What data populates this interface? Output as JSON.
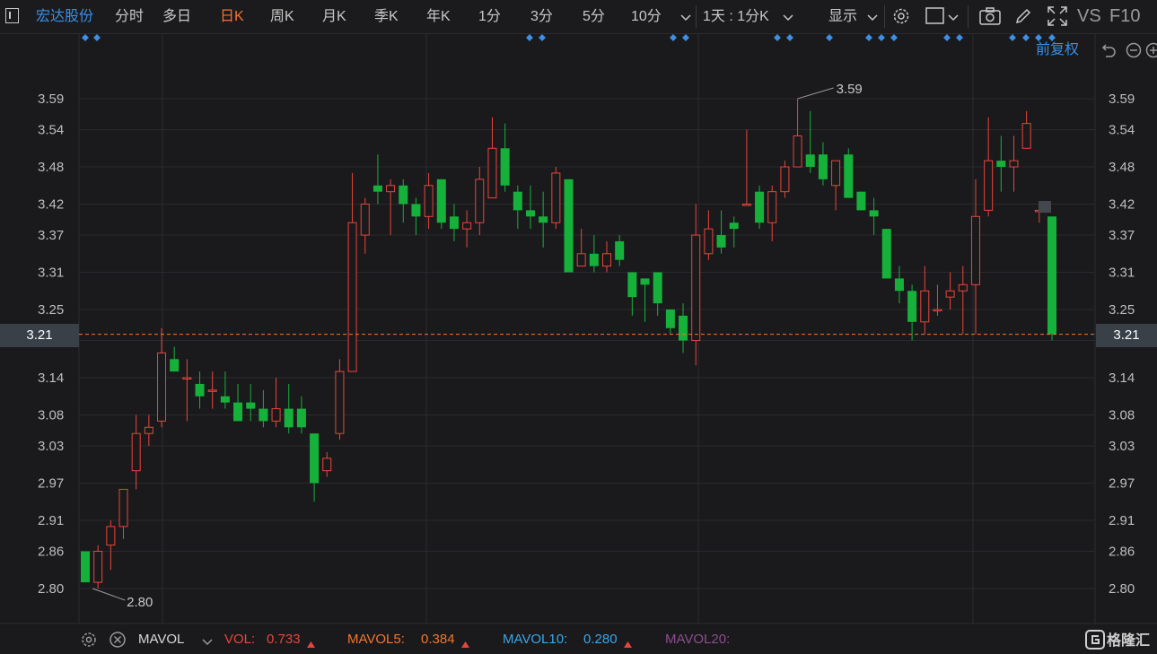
{
  "toolbar": {
    "stock_name": "宏达股份",
    "tabs": [
      "分时",
      "多日",
      "日K",
      "周K",
      "月K",
      "季K",
      "年K",
      "1分",
      "3分",
      "5分",
      "10分"
    ],
    "active_tab": "日K",
    "period_select": "1天 : 1分K",
    "display_label": "显示",
    "vs_label": "VS",
    "f10_label": "F10"
  },
  "adjust_label": "前复权",
  "axis": {
    "ticks": [
      "3.59",
      "3.54",
      "3.48",
      "3.42",
      "3.37",
      "3.31",
      "3.25",
      "3.20",
      "3.14",
      "3.08",
      "3.03",
      "2.97",
      "2.91",
      "2.86",
      "2.80"
    ],
    "current_price": "3.21",
    "high_label": "3.59",
    "low_label": "2.80"
  },
  "chart_data": {
    "type": "candlestick",
    "ylim": [
      2.77,
      3.63
    ],
    "current_price": 3.21,
    "high": 3.59,
    "low": 2.8,
    "candles": [
      [
        2.86,
        2.81,
        2.86,
        2.81
      ],
      [
        2.81,
        2.86,
        2.87,
        2.8
      ],
      [
        2.87,
        2.9,
        2.91,
        2.83
      ],
      [
        2.9,
        2.96,
        2.96,
        2.88
      ],
      [
        2.99,
        3.05,
        3.08,
        2.96
      ],
      [
        3.05,
        3.06,
        3.08,
        3.03
      ],
      [
        3.07,
        3.18,
        3.22,
        3.06
      ],
      [
        3.17,
        3.15,
        3.19,
        3.15
      ],
      [
        3.14,
        3.14,
        3.17,
        3.07
      ],
      [
        3.13,
        3.11,
        3.15,
        3.09
      ],
      [
        3.12,
        3.12,
        3.15,
        3.09
      ],
      [
        3.11,
        3.1,
        3.15,
        3.09
      ],
      [
        3.1,
        3.07,
        3.13,
        3.07
      ],
      [
        3.1,
        3.09,
        3.13,
        3.07
      ],
      [
        3.09,
        3.07,
        3.12,
        3.06
      ],
      [
        3.07,
        3.09,
        3.14,
        3.06
      ],
      [
        3.09,
        3.06,
        3.13,
        3.05
      ],
      [
        3.09,
        3.06,
        3.11,
        3.05
      ],
      [
        3.05,
        2.97,
        3.05,
        2.94
      ],
      [
        2.99,
        3.01,
        3.02,
        2.98
      ],
      [
        3.05,
        3.15,
        3.17,
        3.04
      ],
      [
        3.15,
        3.39,
        3.47,
        3.15
      ],
      [
        3.37,
        3.42,
        3.43,
        3.34
      ],
      [
        3.45,
        3.44,
        3.5,
        3.42
      ],
      [
        3.44,
        3.45,
        3.46,
        3.37
      ],
      [
        3.45,
        3.42,
        3.46,
        3.39
      ],
      [
        3.42,
        3.4,
        3.43,
        3.37
      ],
      [
        3.4,
        3.45,
        3.47,
        3.38
      ],
      [
        3.46,
        3.39,
        3.46,
        3.38
      ],
      [
        3.4,
        3.38,
        3.42,
        3.36
      ],
      [
        3.38,
        3.39,
        3.41,
        3.35
      ],
      [
        3.39,
        3.46,
        3.48,
        3.37
      ],
      [
        3.43,
        3.51,
        3.56,
        3.43
      ],
      [
        3.51,
        3.45,
        3.55,
        3.44
      ],
      [
        3.44,
        3.41,
        3.45,
        3.38
      ],
      [
        3.41,
        3.4,
        3.45,
        3.38
      ],
      [
        3.4,
        3.39,
        3.44,
        3.35
      ],
      [
        3.39,
        3.47,
        3.48,
        3.38
      ],
      [
        3.46,
        3.31,
        3.46,
        3.31
      ],
      [
        3.32,
        3.34,
        3.38,
        3.32
      ],
      [
        3.34,
        3.32,
        3.37,
        3.31
      ],
      [
        3.32,
        3.34,
        3.36,
        3.31
      ],
      [
        3.36,
        3.33,
        3.37,
        3.32
      ],
      [
        3.31,
        3.27,
        3.31,
        3.24
      ],
      [
        3.3,
        3.29,
        3.3,
        3.23
      ],
      [
        3.31,
        3.26,
        3.31,
        3.24
      ],
      [
        3.25,
        3.22,
        3.25,
        3.21
      ],
      [
        3.24,
        3.2,
        3.26,
        3.18
      ],
      [
        3.2,
        3.37,
        3.42,
        3.16
      ],
      [
        3.34,
        3.38,
        3.41,
        3.33
      ],
      [
        3.37,
        3.35,
        3.41,
        3.34
      ],
      [
        3.39,
        3.38,
        3.4,
        3.35
      ],
      [
        3.42,
        3.42,
        3.54,
        3.42
      ],
      [
        3.44,
        3.39,
        3.45,
        3.38
      ],
      [
        3.39,
        3.44,
        3.45,
        3.36
      ],
      [
        3.44,
        3.48,
        3.49,
        3.43
      ],
      [
        3.48,
        3.53,
        3.59,
        3.48
      ],
      [
        3.5,
        3.48,
        3.57,
        3.47
      ],
      [
        3.5,
        3.46,
        3.52,
        3.45
      ],
      [
        3.45,
        3.49,
        3.49,
        3.41
      ],
      [
        3.5,
        3.43,
        3.51,
        3.43
      ],
      [
        3.44,
        3.41,
        3.44,
        3.41
      ],
      [
        3.41,
        3.4,
        3.43,
        3.37
      ],
      [
        3.38,
        3.3,
        3.38,
        3.3
      ],
      [
        3.3,
        3.28,
        3.32,
        3.26
      ],
      [
        3.28,
        3.23,
        3.29,
        3.2
      ],
      [
        3.23,
        3.28,
        3.32,
        3.21
      ],
      [
        3.25,
        3.25,
        3.29,
        3.24
      ],
      [
        3.27,
        3.28,
        3.31,
        3.25
      ],
      [
        3.28,
        3.29,
        3.32,
        3.21
      ],
      [
        3.29,
        3.4,
        3.46,
        3.21
      ],
      [
        3.41,
        3.49,
        3.56,
        3.4
      ],
      [
        3.49,
        3.48,
        3.53,
        3.44
      ],
      [
        3.48,
        3.49,
        3.53,
        3.44
      ],
      [
        3.51,
        3.55,
        3.57,
        3.51
      ],
      [
        3.41,
        3.41,
        3.42,
        3.39
      ],
      [
        3.4,
        3.21,
        3.4,
        3.2
      ]
    ]
  },
  "indicators": {
    "settings_icon": "gear-icon",
    "close_icon": "close-icon",
    "name": "MAVOL",
    "vol_label": "VOL:",
    "vol_value": "0.733",
    "mavol5_label": "MAVOL5:",
    "mavol5_value": "0.384",
    "mavol10_label": "MAVOL10:",
    "mavol10_value": "0.280",
    "mavol20_label": "MAVOL20:"
  },
  "brand": "格隆汇",
  "colors": {
    "up": "#e8453c",
    "down": "#16b13b",
    "accent": "#f0762e",
    "blue": "#3b8fe6",
    "mavol10": "#3aa6e8",
    "mavol20": "#8c4e8e"
  }
}
